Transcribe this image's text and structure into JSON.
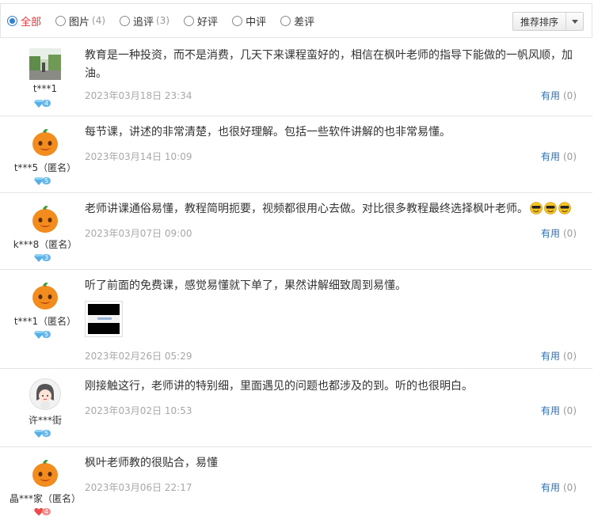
{
  "filters": [
    {
      "label": "全部",
      "count": "",
      "checked": true
    },
    {
      "label": "图片",
      "count": "(4)",
      "checked": false
    },
    {
      "label": "追评",
      "count": "(3)",
      "checked": false
    },
    {
      "label": "好评",
      "count": "",
      "checked": false
    },
    {
      "label": "中评",
      "count": "",
      "checked": false
    },
    {
      "label": "差评",
      "count": "",
      "checked": false
    }
  ],
  "sort": {
    "label": "推荐排序"
  },
  "reviews": [
    {
      "user": "t***1",
      "level": "4",
      "avatar": "photo-avatar",
      "text": "教育是一种投资，而不是消费，几天下来课程蛮好的，相信在枫叶老师的指导下能做的一帆风顺，加油。",
      "date": "2023年03月18日 23:34",
      "useful_label": "有用",
      "useful_count": "(0)"
    },
    {
      "user": "t***5（匿名）",
      "level": "5",
      "avatar": "orange-mascot-avatar",
      "text": "每节课，讲述的非常清楚，也很好理解。包括一些软件讲解的也非常易懂。",
      "date": "2023年03月14日 10:09",
      "useful_label": "有用",
      "useful_count": "(0)"
    },
    {
      "user": "k***8（匿名）",
      "level": "3",
      "avatar": "orange-mascot-avatar",
      "text": "老师讲课通俗易懂，教程简明扼要，视频都很用心去做。对比很多教程最终选择枫叶老师。",
      "date": "2023年03月07日 09:00",
      "useful_label": "有用",
      "useful_count": "(0)",
      "emojis": [
        "cool-emoji",
        "cool-emoji",
        "cool-emoji"
      ]
    },
    {
      "user": "t***1（匿名）",
      "level": "5",
      "avatar": "orange-mascot-avatar",
      "text": "听了前面的免费课，感觉易懂就下单了，果然讲解细致周到易懂。",
      "date": "2023年02月26日 05:29",
      "useful_label": "有用",
      "useful_count": "(0)",
      "has_image": true
    },
    {
      "user": "许***街",
      "level": "5",
      "avatar": "cartoon-girl-avatar",
      "text": "刚接触这行，老师讲的特别细，里面遇见的问题也都涉及的到。听的也很明白。",
      "date": "2023年03月02日 10:53",
      "useful_label": "有用",
      "useful_count": "(0)"
    },
    {
      "user": "晶***家（匿名）",
      "level": "4",
      "avatar": "orange-mascot-avatar",
      "level_style": "heart",
      "text": "枫叶老师教的很贴合，易懂",
      "date": "2023年03月06日 22:17",
      "useful_label": "有用",
      "useful_count": "(0)"
    }
  ],
  "colors": {
    "active_filter": "#e4393c",
    "link": "#2f6fb3",
    "date": "#a8a8a8"
  }
}
